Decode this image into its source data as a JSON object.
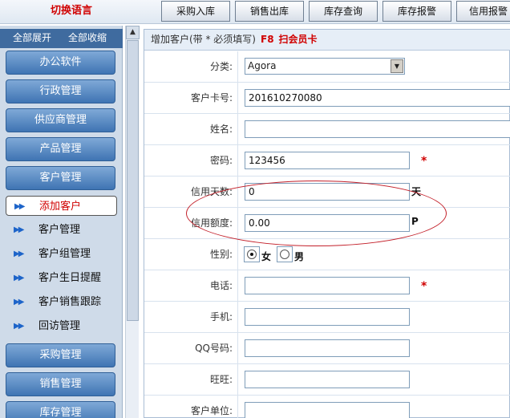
{
  "topbar": {
    "lang_label": "切换语言",
    "tabs": [
      "采购入库",
      "销售出库",
      "库存查询",
      "库存报警",
      "信用报警"
    ]
  },
  "sidebar": {
    "expand_all": "全部展开",
    "collapse_all": "全部收缩",
    "modules_top": [
      "办公软件",
      "行政管理",
      "供应商管理",
      "产品管理",
      "客户管理"
    ],
    "submenu": [
      "添加客户",
      "客户管理",
      "客户组管理",
      "客户生日提醒",
      "客户销售跟踪",
      "回访管理"
    ],
    "modules_bottom": [
      "采购管理",
      "销售管理",
      "库存管理"
    ]
  },
  "form": {
    "header": "增加客户(带 * 必须填写)",
    "hotkey": "F8",
    "scan_label": "扫会员卡",
    "labels": {
      "category": "分类:",
      "card_no": "客户卡号:",
      "name": "姓名:",
      "password": "密码:",
      "credit_days": "信用天数:",
      "credit_limit": "信用额度:",
      "gender": "性别:",
      "phone": "电话:",
      "mobile": "手机:",
      "qq": "QQ号码:",
      "wangwang": "旺旺:",
      "company": "客户单位:"
    },
    "values": {
      "category": "Agora",
      "card_no": "201610270080",
      "name": "",
      "password": "123456",
      "credit_days": "0",
      "credit_limit": "0.00",
      "phone": "",
      "mobile": "",
      "qq": "",
      "wangwang": "",
      "company": ""
    },
    "units": {
      "credit_days": "天",
      "credit_limit": "P"
    },
    "gender_options": [
      "女",
      "男"
    ],
    "gender_selected": "女",
    "required_mark": "*"
  },
  "colors": {
    "accent_red": "#d00000",
    "module_blue": "#3f74b3",
    "sidebar_bg": "#cfdbe9",
    "annotation_ellipse": "#c3202a"
  }
}
